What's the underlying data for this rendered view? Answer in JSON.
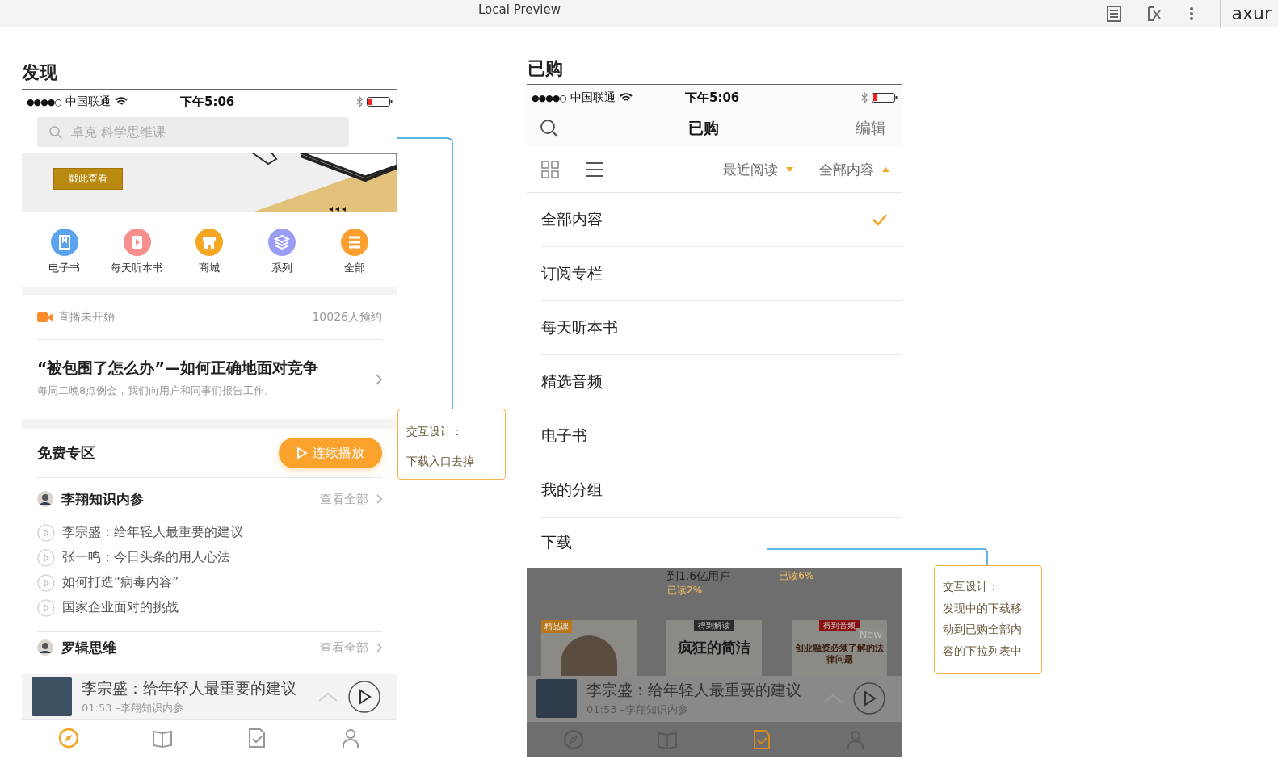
{
  "topbar": {
    "title": "Local Preview",
    "logo": "axur"
  },
  "discover": {
    "heading": "发现",
    "status": {
      "signal": "●●●●○",
      "carrier": "中国联通",
      "time": "下午5:06"
    },
    "search": {
      "placeholder": "卓克·科学思维课"
    },
    "banner": {
      "button": "戳此查看"
    },
    "categories": [
      {
        "kind": "book",
        "label": "电子书",
        "color": "#5ba3ee"
      },
      {
        "kind": "play",
        "label": "每天听本书",
        "color": "#f78f8f"
      },
      {
        "kind": "shop",
        "label": "商城",
        "color": "#f5a623"
      },
      {
        "kind": "layers",
        "label": "系列",
        "color": "#9b9df5"
      },
      {
        "kind": "list",
        "label": "全部",
        "color": "#fb9f2e"
      }
    ],
    "live": {
      "status": "直播未开始",
      "count": "10026人预约",
      "title": "“被包围了怎么办”—如何正确地面对竞争",
      "subtitle": "每周二晚8点例会，我们向用户和同事们报告工作。"
    },
    "free": {
      "heading": "免费专区",
      "button": "连续播放",
      "columns": [
        {
          "name": "李翔知识内参",
          "link": "查看全部",
          "episodes": [
            "李宗盛：给年轻人最重要的建议",
            "张一鸣：今日头条的用人心法",
            "如何打造“病毒内容”",
            "国家企业面对的挑战"
          ]
        },
        {
          "name": "罗辑思维",
          "link": "查看全部"
        }
      ]
    },
    "player": {
      "title": "李宗盛：给年轻人最重要的建议",
      "time": "01:53",
      "source": "–李翔知识内参"
    },
    "tabbar": [
      {
        "kind": "compass",
        "selected": true
      },
      {
        "kind": "book",
        "selected": false
      },
      {
        "kind": "doc",
        "selected": false
      },
      {
        "kind": "person",
        "selected": false
      }
    ]
  },
  "purchased": {
    "heading": "已购",
    "status": {
      "signal": "●●●●○",
      "carrier": "中国联通",
      "time": "下午5:06"
    },
    "nav": {
      "title": "已购",
      "edit": "编辑"
    },
    "filters": [
      {
        "label": "最近阅读",
        "open": false
      },
      {
        "label": "全部内容",
        "open": true
      }
    ],
    "menu": [
      {
        "label": "全部内容",
        "selected": true
      },
      {
        "label": "订阅专栏",
        "selected": false
      },
      {
        "label": "每天听本书",
        "selected": false
      },
      {
        "label": "精选音频",
        "selected": false
      },
      {
        "label": "电子书",
        "selected": false
      },
      {
        "label": "我的分组",
        "selected": false
      },
      {
        "label": "下载",
        "selected": false
      }
    ],
    "behind": {
      "caption": "到1.6亿用户",
      "progress": [
        "已读2%",
        "已读6%"
      ],
      "covers": [
        {
          "kind": "portrait",
          "badge": "精品课"
        },
        {
          "kind": "title",
          "tag": "得到解读",
          "title": "疯狂的简洁"
        },
        {
          "kind": "title",
          "tag": "得到音频",
          "title": "创业融资必须了解的法律问题",
          "badge": "New"
        }
      ]
    },
    "player": {
      "title": "李宗盛：给年轻人最重要的建议",
      "time": "01:53",
      "source": "–李翔知识内参"
    },
    "tabbar": [
      {
        "kind": "compass",
        "selected": false
      },
      {
        "kind": "book",
        "selected": false
      },
      {
        "kind": "doc",
        "selected": true
      },
      {
        "kind": "person",
        "selected": false
      }
    ]
  },
  "notes": [
    {
      "title": "交互设计：",
      "text": "下载入口去掉"
    },
    {
      "title": "交互设计：",
      "text": "发现中的下载移动到已购全部内容的下拉列表中"
    }
  ]
}
